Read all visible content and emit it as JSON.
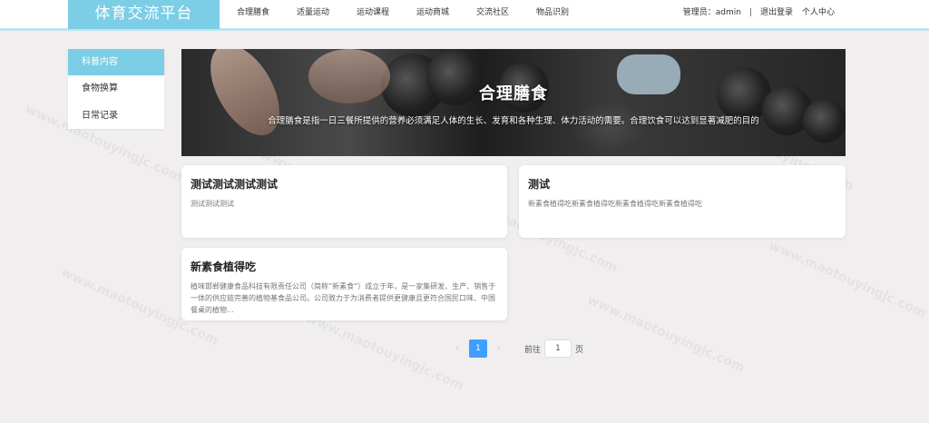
{
  "header": {
    "brand": "体育交流平台",
    "nav": [
      "合理膳食",
      "适量运动",
      "运动课程",
      "运动商城",
      "交流社区",
      "物品识别"
    ],
    "user_label": "管理员：admin",
    "separator": "|",
    "logout": "退出登录",
    "profile": "个人中心"
  },
  "sidebar": {
    "items": [
      {
        "label": "科普内容"
      },
      {
        "label": "食物换算"
      },
      {
        "label": "日常记录"
      }
    ]
  },
  "banner": {
    "title": "合理膳食",
    "text": "合理膳食是指一日三餐所提供的营养必须满足人体的生长、发育和各种生理、体力活动的需要。合理饮食可以达到显著减肥的目的"
  },
  "cards": [
    {
      "title": "测试测试测试测试",
      "desc": "测试测试测试"
    },
    {
      "title": "测试",
      "desc": "新素食植得吃新素食植得吃新素食植得吃新素食植得吃"
    },
    {
      "title": "新素食植得吃",
      "desc": "植味邯郸健康食品科技有限责任公司（简称“新素食”）成立于年，是一家集研发、生产、销售于一体的供应链完善的植物基食品公司。公司致力于为消费者提供更健康且更符合国民口味、中国餐桌的植物..."
    }
  ],
  "pagination": {
    "prev": "‹",
    "current": "1",
    "next": "›",
    "goto_label": "前往",
    "goto_value": "1",
    "page_suffix": "页"
  },
  "watermark": "www.maotouyingjc.com",
  "colors": {
    "brand_bg": "#7ccde6",
    "active_sidebar": "#7ccde6",
    "page_active": "#409eff",
    "background": "#f0eeee"
  }
}
